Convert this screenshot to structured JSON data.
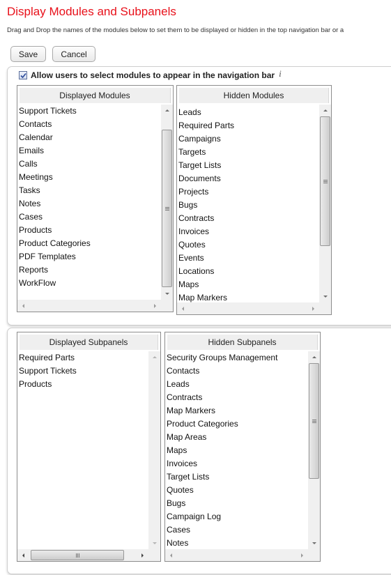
{
  "page": {
    "title": "Display Modules and Subpanels",
    "description": "Drag and Drop the names of the modules below to set them to be displayed or hidden in the top navigation bar or a"
  },
  "toolbar": {
    "save_label": "Save",
    "cancel_label": "Cancel"
  },
  "modules_panel": {
    "allow_checkbox": {
      "label": "Allow users to select modules to appear in the navigation bar",
      "checked": true,
      "info_icon": "i"
    },
    "displayed": {
      "header": "Displayed Modules",
      "items": [
        "Support Tickets",
        "Contacts",
        "Calendar",
        "Emails",
        "Calls",
        "Meetings",
        "Tasks",
        "Notes",
        "Cases",
        "Products",
        "Product Categories",
        "PDF Templates",
        "Reports",
        "WorkFlow"
      ]
    },
    "hidden": {
      "header": "Hidden Modules",
      "items": [
        "Leads",
        "Required Parts",
        "Campaigns",
        "Targets",
        "Target Lists",
        "Documents",
        "Projects",
        "Bugs",
        "Contracts",
        "Invoices",
        "Quotes",
        "Events",
        "Locations",
        "Maps",
        "Map Markers"
      ]
    }
  },
  "subpanels_panel": {
    "displayed": {
      "header": "Displayed Subpanels",
      "items": [
        "Required Parts",
        "Support Tickets",
        "Products"
      ]
    },
    "hidden": {
      "header": "Hidden Subpanels",
      "items": [
        "Security Groups Management",
        "Contacts",
        "Leads",
        "Contracts",
        "Map Markers",
        "Product Categories",
        "Map Areas",
        "Maps",
        "Invoices",
        "Target Lists",
        "Quotes",
        "Bugs",
        "Campaign Log",
        "Cases",
        "Notes"
      ]
    }
  }
}
